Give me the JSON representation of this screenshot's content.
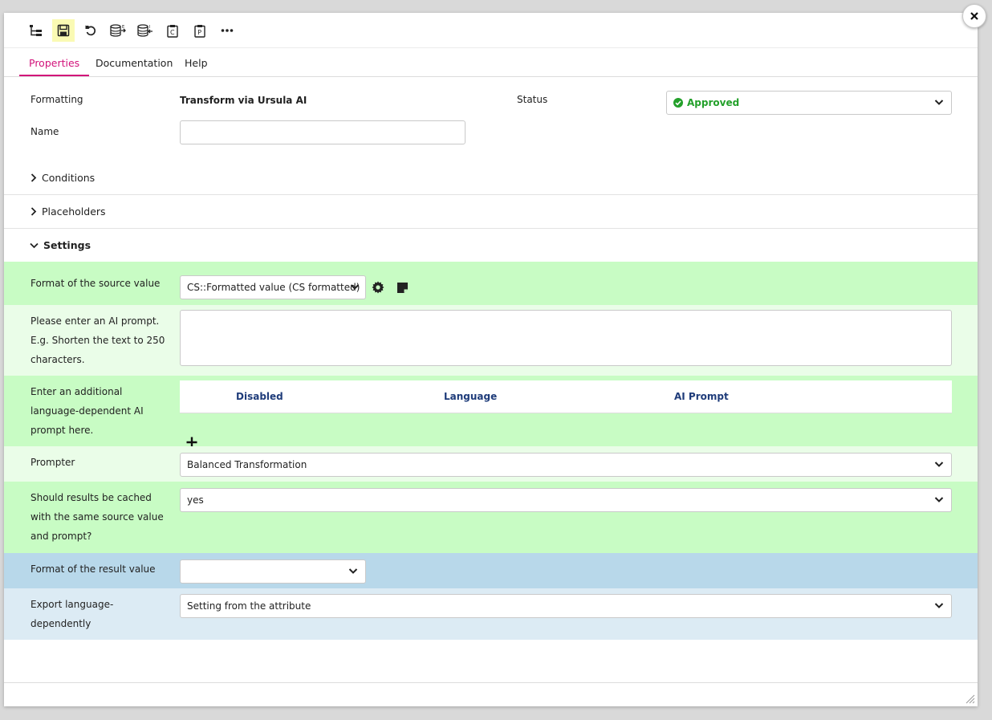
{
  "toolbar": {
    "buttons": [
      {
        "icon": "tree-structure-icon"
      },
      {
        "icon": "save-icon",
        "active": true
      },
      {
        "icon": "undo-icon"
      },
      {
        "icon": "database-export-icon"
      },
      {
        "icon": "database-import-icon"
      },
      {
        "icon": "clipboard-c-icon",
        "letter": "C"
      },
      {
        "icon": "clipboard-p-icon",
        "letter": "P"
      },
      {
        "icon": "more-icon"
      }
    ]
  },
  "tabs": [
    {
      "label": "Properties",
      "active": true
    },
    {
      "label": "Documentation"
    },
    {
      "label": "Help"
    }
  ],
  "header": {
    "formatting_label": "Formatting",
    "formatting_value": "Transform via Ursula AI",
    "status_label": "Status",
    "status_value": "Approved",
    "name_label": "Name",
    "name_value": ""
  },
  "sections": {
    "conditions": "Conditions",
    "placeholders": "Placeholders",
    "settings": "Settings"
  },
  "settings": {
    "source_format_label": "Format of the source value",
    "source_format_value": "CS::Formatted value (CS formatted)",
    "ai_prompt_label": "Please enter an AI prompt. E.g. Shorten the text to 250 characters.",
    "ai_prompt_value": "",
    "lang_prompt_label": "Enter an additional language-dependent AI prompt here.",
    "lang_table_columns": [
      "Disabled",
      "Language",
      "AI Prompt"
    ],
    "prompter_label": "Prompter",
    "prompter_value": "Balanced Transformation",
    "cache_label": "Should results be cached with the same source value and prompt?",
    "cache_value": "yes",
    "result_format_label": "Format of the result value",
    "result_format_value": "",
    "export_label": "Export language-dependently",
    "export_value": "Setting from the attribute"
  },
  "colors": {
    "accent": "#d2127a",
    "status_green": "#23a02a",
    "row_green_dark": "#c8fcc4",
    "row_green_light": "#eafde8",
    "row_blue_dark": "#b8d8ea",
    "row_blue_light": "#dcebf4",
    "highlight_yellow": "#fafab4",
    "table_header_text": "#1f3c7a"
  }
}
